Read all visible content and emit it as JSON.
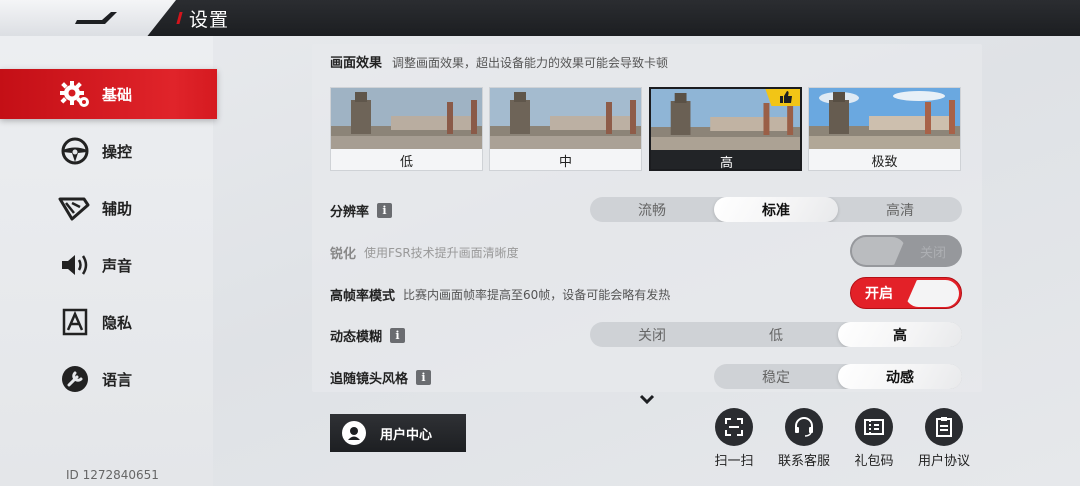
{
  "header": {
    "title": "设置"
  },
  "sidebar": {
    "items": [
      {
        "label": "基础",
        "icon": "gear-icon",
        "active": true
      },
      {
        "label": "操控",
        "icon": "steering-wheel-icon",
        "active": false
      },
      {
        "label": "辅助",
        "icon": "assist-icon",
        "active": false
      },
      {
        "label": "声音",
        "icon": "speaker-icon",
        "active": false
      },
      {
        "label": "隐私",
        "icon": "privacy-icon",
        "active": false
      },
      {
        "label": "语言",
        "icon": "wrench-icon",
        "active": false
      }
    ],
    "user_id": "ID 1272840651"
  },
  "graphics": {
    "title": "画面效果",
    "desc": "调整画面效果，超出设备能力的效果可能会导致卡顿",
    "options": [
      "低",
      "中",
      "高",
      "极致"
    ],
    "selected": "高",
    "badge_icon": "thumbs-up-icon"
  },
  "resolution": {
    "label": "分辨率",
    "options": [
      "流畅",
      "标准",
      "高清"
    ],
    "selected": "标准"
  },
  "sharpen": {
    "label": "锐化",
    "desc": "使用FSR技术提升画面清晰度",
    "state": "关闭"
  },
  "high_fps": {
    "label": "高帧率模式",
    "desc": "比赛内画面帧率提高至60帧，设备可能会略有发热",
    "state": "开启"
  },
  "motion_blur": {
    "label": "动态模糊",
    "options": [
      "关闭",
      "低",
      "高"
    ],
    "selected": "高"
  },
  "camera_style": {
    "label": "追随镜头风格",
    "options": [
      "稳定",
      "动感"
    ],
    "selected": "动感"
  },
  "bottom": {
    "user_center": "用户中心",
    "actions": [
      {
        "label": "扫一扫",
        "icon": "scan-icon"
      },
      {
        "label": "联系客服",
        "icon": "headset-icon"
      },
      {
        "label": "礼包码",
        "icon": "gift-code-icon"
      },
      {
        "label": "用户协议",
        "icon": "document-icon"
      }
    ]
  },
  "colors": {
    "accent": "#d4141c",
    "dark": "#1d1f22"
  }
}
